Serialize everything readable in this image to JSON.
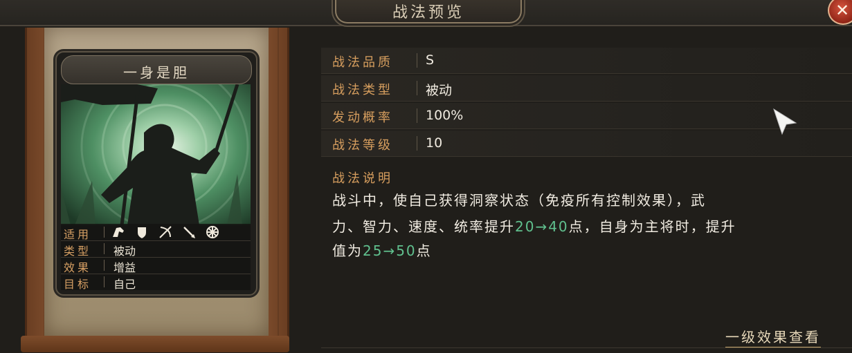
{
  "window": {
    "title": "战法预览",
    "close_icon": "close-icon"
  },
  "card": {
    "name": "一身是胆",
    "stats": [
      {
        "key": "适用",
        "value": ""
      },
      {
        "key": "类型",
        "value": "被动"
      },
      {
        "key": "效果",
        "value": "增益"
      },
      {
        "key": "目标",
        "value": "自己"
      }
    ],
    "unit_icons": [
      "cavalry-icon",
      "shield-icon",
      "archer-icon",
      "spear-icon",
      "siege-icon"
    ]
  },
  "info": {
    "rows": [
      {
        "key": "战法品质",
        "value": "S"
      },
      {
        "key": "战法类型",
        "value": "被动"
      },
      {
        "key": "发动概率",
        "value": "100%"
      },
      {
        "key": "战法等级",
        "value": "10"
      }
    ],
    "desc_title": "战法说明",
    "desc": {
      "line1": "战斗中，使自己获得洞察状态（免疫所有控制效果），武",
      "line2_a": "力、智力、速度、统率提升",
      "line2_green": "20→40",
      "line2_b": "点，自身为主将时，提升",
      "line3_a": "值为",
      "line3_green": "25→50",
      "line3_b": "点"
    }
  },
  "link": {
    "label": "一级效果查看"
  },
  "colors": {
    "accent_key": "#d89f5f",
    "highlight_green": "#60c08e",
    "close_red": "#b83a28"
  }
}
